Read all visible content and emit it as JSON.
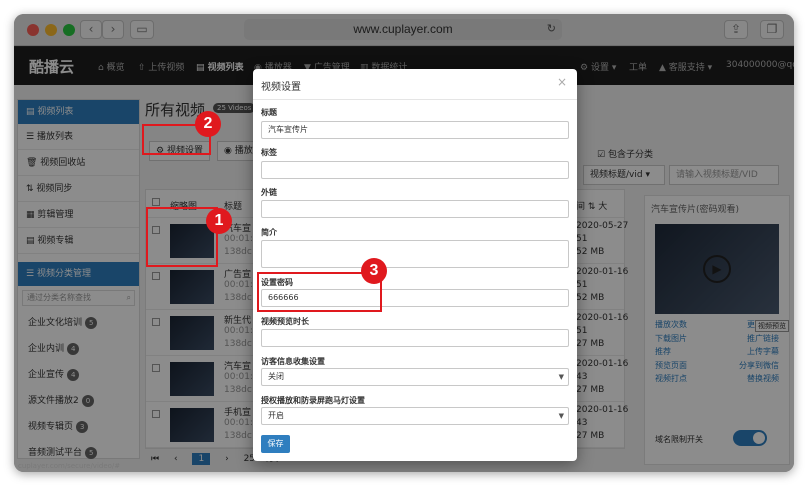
{
  "browser": {
    "url": "www.cuplayer.com"
  },
  "app": {
    "logo": "酷播云",
    "nav": [
      "概览",
      "上传视频",
      "视频列表",
      "播放器",
      "广告管理",
      "数据统计"
    ],
    "right_nav": [
      "设置",
      "工单",
      "客服支持",
      "304000000@qq.co"
    ]
  },
  "sidebar": {
    "head": "视频列表",
    "items": [
      "播放列表",
      "视频回收站",
      "视频同步",
      "剪辑管理",
      "视频专辑"
    ],
    "cat_head": "视频分类管理",
    "search_placeholder": "通过分类名称查找",
    "folders": [
      {
        "name": "企业文化培训",
        "count": "5"
      },
      {
        "name": "企业内训",
        "count": "4"
      },
      {
        "name": "企业宣传",
        "count": "4"
      },
      {
        "name": "源文件播放2",
        "count": "0"
      },
      {
        "name": "视频专辑页",
        "count": "3"
      },
      {
        "name": "音频测试平台",
        "count": "5"
      }
    ]
  },
  "main": {
    "title": "所有视频",
    "count_badge": "25 Videos",
    "btn_settings": "视频设置",
    "btn_play": "播放设",
    "include_sub": "包含子分类",
    "select_label": "视频标题/vid",
    "search_placeholder": "请输入视频标题/VID",
    "col_thumb": "缩略图",
    "col_title": "标题",
    "col_time": "间",
    "rows": [
      {
        "title": "汽车宣",
        "l2": "00:01:",
        "l3": "138dc",
        "d1": "2020-05-27",
        "d2": "51",
        "d3": "52 MB"
      },
      {
        "title": "广告宣",
        "l2": "00:01:",
        "l3": "138dc",
        "d1": "2020-01-16",
        "d2": "51",
        "d3": "52 MB"
      },
      {
        "title": "新生代",
        "l2": "00:01:",
        "l3": "138dc",
        "d1": "2020-01-16",
        "d2": "51",
        "d3": "27 MB"
      },
      {
        "title": "汽车宣",
        "l2": "00:01:",
        "l3": "138dc",
        "d1": "2020-01-16",
        "d2": "43",
        "d3": "27 MB"
      },
      {
        "title": "手机宣",
        "l2": "00:01:",
        "l3": "138dc",
        "d1": "2020-01-16",
        "d2": "43",
        "d3": "27 MB"
      }
    ],
    "pagination": [
      "1",
      "2598/页"
    ]
  },
  "right_panel": {
    "title": "汽车宣传片(密码观看)",
    "links": [
      "播放次数",
      "更换片头",
      "下载图片",
      "推广链接",
      "推荐",
      "上传字幕",
      "预览页面",
      "分享到微信",
      "视频打点",
      "替换视频"
    ],
    "tooltip": "视频预览",
    "toggle_label": "域名限制开关"
  },
  "modal": {
    "title": "视频设置",
    "fields": [
      {
        "label": "标题",
        "value": "汽车宣传片"
      },
      {
        "label": "标签",
        "value": ""
      },
      {
        "label": "外链",
        "value": ""
      },
      {
        "label": "简介",
        "value": ""
      },
      {
        "label": "设置密码",
        "value": "666666"
      },
      {
        "label": "视频预览时长",
        "value": ""
      },
      {
        "label": "访客信息收集设置",
        "value": "关闭"
      },
      {
        "label": "授权播放和防录屏跑马灯设置",
        "value": "开启"
      }
    ],
    "save": "保存"
  },
  "callouts": [
    "1",
    "2",
    "3"
  ],
  "status_url": "cuplayer.com/secure/video/#"
}
